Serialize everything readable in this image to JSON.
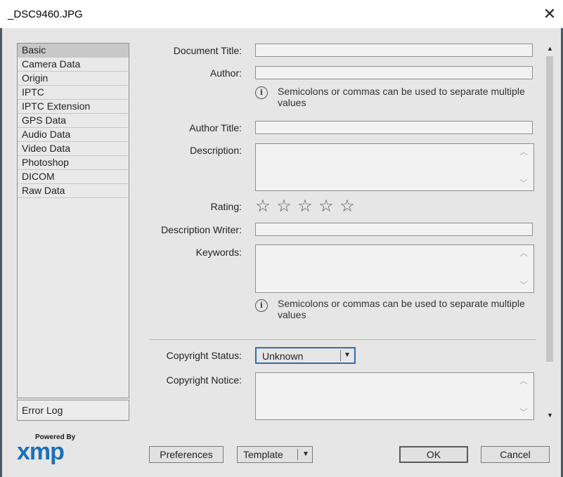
{
  "window": {
    "title": "_DSC9460.JPG",
    "close_glyph": "✕"
  },
  "sidebar": {
    "items": [
      {
        "label": "Basic"
      },
      {
        "label": "Camera Data"
      },
      {
        "label": "Origin"
      },
      {
        "label": "IPTC"
      },
      {
        "label": "IPTC Extension"
      },
      {
        "label": "GPS Data"
      },
      {
        "label": "Audio Data"
      },
      {
        "label": "Video Data"
      },
      {
        "label": "Photoshop"
      },
      {
        "label": "DICOM"
      },
      {
        "label": "Raw Data"
      }
    ],
    "selected": "Basic",
    "error_log": "Error Log"
  },
  "form": {
    "document_title_label": "Document Title:",
    "document_title_value": "",
    "author_label": "Author:",
    "author_value": "",
    "hint_text": "Semicolons or commas can be used to separate multiple values",
    "author_title_label": "Author Title:",
    "author_title_value": "",
    "description_label": "Description:",
    "rating_label": "Rating:",
    "rating_value": 0,
    "rating_max": 5,
    "description_writer_label": "Description Writer:",
    "description_writer_value": "",
    "keywords_label": "Keywords:",
    "copyright_status_label": "Copyright Status:",
    "copyright_status_value": "Unknown",
    "copyright_notice_label": "Copyright Notice:"
  },
  "branding": {
    "powered_by": "Powered By",
    "logo": "xmp",
    "logo_color": "#1c6fb8"
  },
  "buttons": {
    "preferences": "Preferences",
    "template": "Template",
    "ok": "OK",
    "cancel": "Cancel"
  },
  "icons": {
    "info": "info-icon",
    "star": "star-outline-icon",
    "dropdown": "caret-down-icon"
  },
  "colors": {
    "dialog_bg": "#e6e6e6",
    "focus_border": "#2f6fb0"
  }
}
